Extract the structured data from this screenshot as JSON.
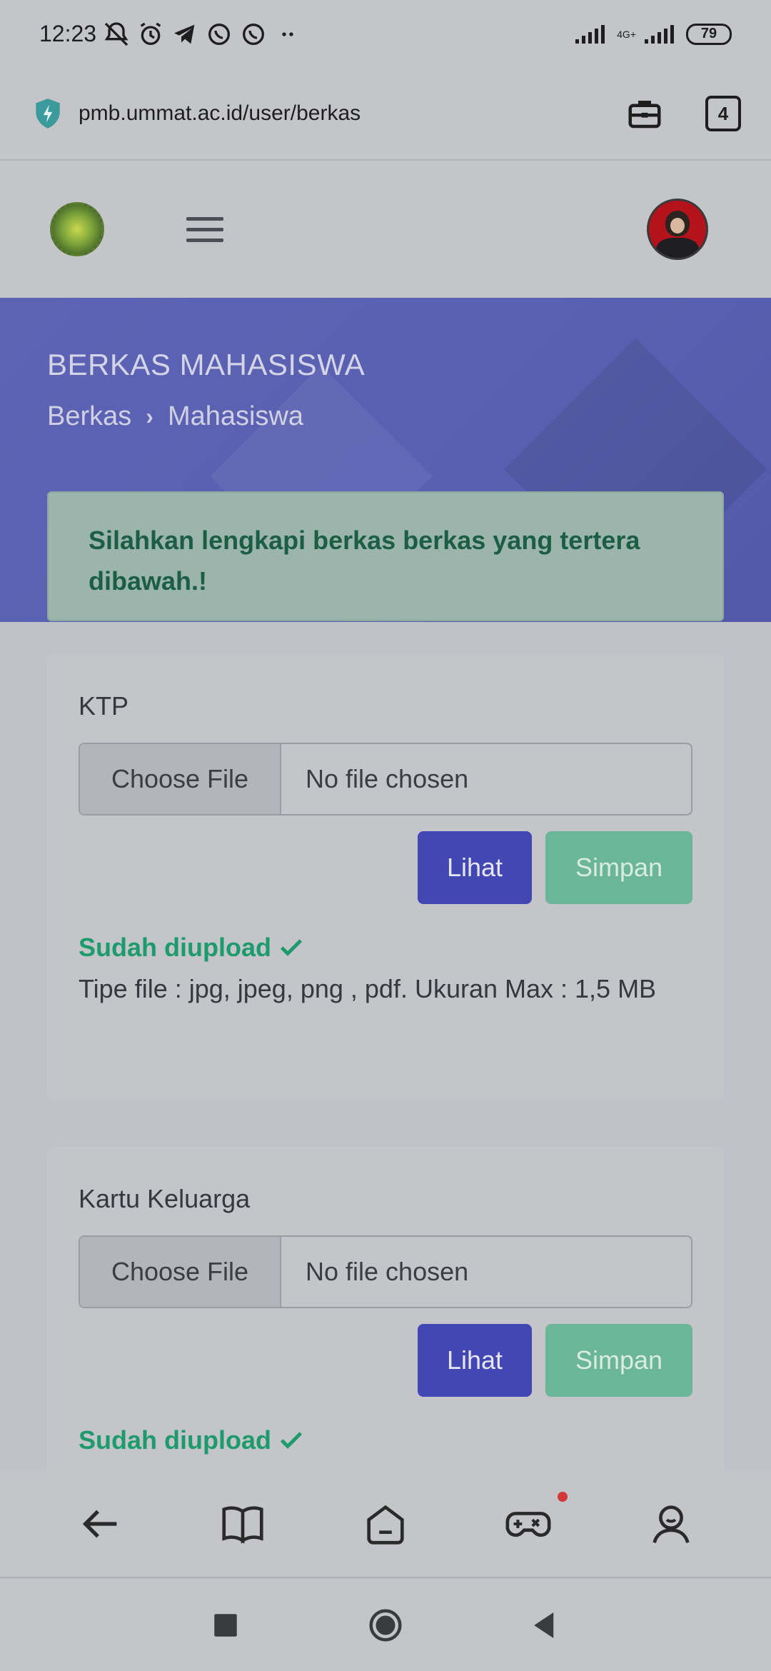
{
  "status_bar": {
    "time": "12:23",
    "network": "4G+",
    "battery": "79"
  },
  "browser": {
    "url": "pmb.ummat.ac.id/user/berkas",
    "tab_count": "4"
  },
  "hero": {
    "title": "BERKAS MAHASISWA",
    "breadcrumb": [
      "Berkas",
      "Mahasiswa"
    ]
  },
  "alert": {
    "text": "Silahkan lengkapi berkas berkas yang tertera dibawah.!"
  },
  "cards": [
    {
      "label": "KTP",
      "choose_file": "Choose File",
      "file_name": "No file chosen",
      "lihat": "Lihat",
      "simpan": "Simpan",
      "status": "Sudah diupload",
      "hint": "Tipe file : jpg, jpeg, png , pdf. Ukuran Max : 1,5 MB"
    },
    {
      "label": "Kartu Keluarga",
      "choose_file": "Choose File",
      "file_name": "No file chosen",
      "lihat": "Lihat",
      "simpan": "Simpan",
      "status": "Sudah diupload"
    }
  ],
  "bottom_nav": [
    "back-icon",
    "book-icon",
    "home-icon",
    "game-controller-icon",
    "profile-icon"
  ],
  "colors": {
    "primary": "#4247b3",
    "success": "#1e9b6c",
    "hero": "#5960b1"
  }
}
